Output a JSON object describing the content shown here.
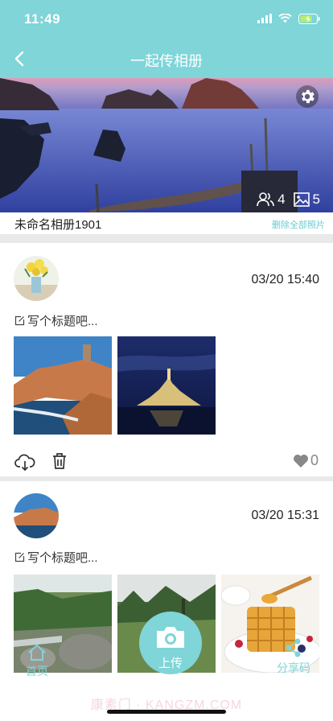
{
  "status": {
    "time": "11:49"
  },
  "nav": {
    "title": "一起传相册",
    "back_icon": "chevron-left-icon"
  },
  "album": {
    "name": "未命名相册1901",
    "delete_all": "删除全部照片",
    "members_count": "4",
    "photos_count": "5"
  },
  "posts": [
    {
      "time": "03/20 15:40",
      "caption": "写个标题吧...",
      "likes": "0"
    },
    {
      "time": "03/20 15:31",
      "caption": "写个标题吧..."
    }
  ],
  "tabbar": {
    "home": "首页",
    "upload": "上传",
    "share": "分享码"
  },
  "watermark": "康素门 · KANGZM.COM",
  "colors": {
    "accent": "#7fd5d8",
    "link": "#6cc9cc"
  }
}
